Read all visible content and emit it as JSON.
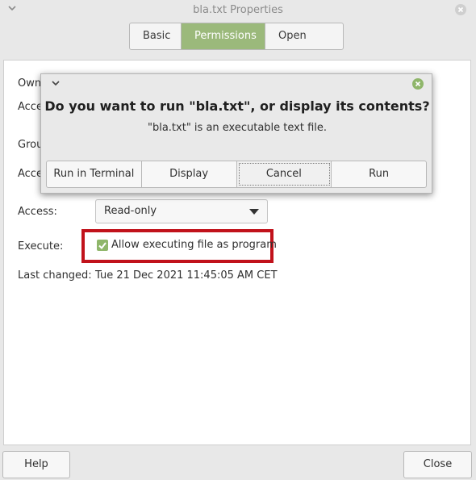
{
  "window": {
    "title": "bla.txt Properties",
    "menu_icon": "chevron-down-icon",
    "close_icon": "close-icon"
  },
  "tabs": [
    {
      "label": "Basic",
      "active": false
    },
    {
      "label": "Permissions",
      "active": true
    },
    {
      "label": "Open With",
      "active": false
    }
  ],
  "permissions": {
    "owner_label": "Own",
    "access_label_1": "Acce",
    "group_label": "Grou",
    "access_label_2": "Acce",
    "access_label": "Access:",
    "access_value": "Read-only",
    "execute_label": "Execute:",
    "execute_checkbox_label": "Allow executing file as program",
    "execute_checked": true,
    "last_changed_label": "Last changed:",
    "last_changed_value": "Tue 21 Dec 2021 11:45:05 AM CET"
  },
  "footer": {
    "help_label": "Help",
    "close_label": "Close"
  },
  "dialog": {
    "heading": "Do you want to run \"bla.txt\", or display its contents?",
    "body": "\"bla.txt\" is an executable text file.",
    "buttons": [
      "Run in Terminal",
      "Display",
      "Cancel",
      "Run"
    ],
    "focused_button": "Cancel"
  },
  "colors": {
    "accent": "#9bb97b",
    "highlight_box": "#c1121b",
    "checkbox": "#8fb66a"
  }
}
